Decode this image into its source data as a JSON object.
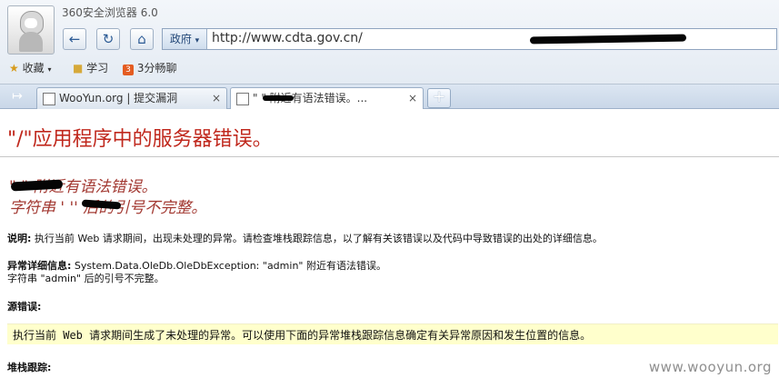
{
  "browser": {
    "title": "360安全浏览器 6.0",
    "back_icon": "back-arrow-icon",
    "refresh_icon": "refresh-icon",
    "home_icon": "home-icon",
    "address_tag": "政府",
    "url": "http://www.cdta.gov.cn/"
  },
  "bookmarks": {
    "favorites": "收藏",
    "study": "学习",
    "chat": "3分畅聊"
  },
  "tabs": [
    {
      "label": "WooYun.org | 提交漏洞",
      "close": "×"
    },
    {
      "label": "\"         \" 附近有语法错误。...",
      "close": "×"
    }
  ],
  "new_tab_label": "+",
  "page": {
    "title": "\"/\"应用程序中的服务器错误。",
    "error_line_1": "\"        \" 附近有语法错误。",
    "error_line_2": "字符串 '         '' 后的引号不完整。",
    "description_label": "说明:",
    "description_text": " 执行当前 Web 请求期间，出现未处理的异常。请检查堆栈跟踪信息，以了解有关该错误以及代码中导致错误的出处的详细信息。",
    "exception_label": "异常详细信息:",
    "exception_text": " System.Data.OleDb.OleDbException: \"admin\" 附近有语法错误。",
    "exception_line_2": "字符串 \"admin\" 后的引号不完整。",
    "source_error_label": "源错误:",
    "source_error_text": "执行当前 Web 请求期间生成了未处理的异常。可以使用下面的异常堆栈跟踪信息确定有关异常原因和发生位置的信息。",
    "stack_trace_label": "堆栈跟踪:",
    "watermark": "www.wooyun.org"
  }
}
